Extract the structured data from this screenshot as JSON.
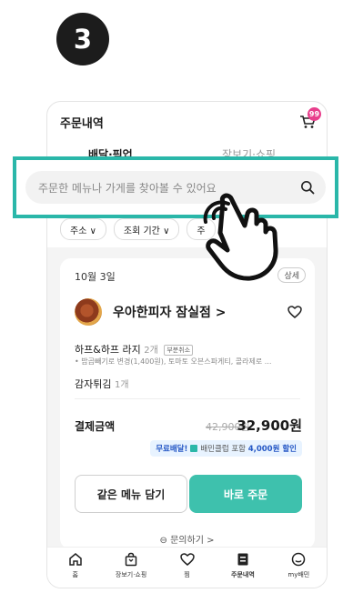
{
  "step_number": "3",
  "header": {
    "title": "주문내역",
    "cart_badge": "99"
  },
  "tabs": [
    {
      "label": "배달·픽업",
      "active": true
    },
    {
      "label": "장보기·쇼핑",
      "active": false
    }
  ],
  "search": {
    "placeholder": "주문한 메뉴나 가게를 찾아볼 수 있어요"
  },
  "filters": [
    "주소 ∨",
    "조회 기간 ∨",
    "주"
  ],
  "order": {
    "date": "10월 3일",
    "detail_label": "상세",
    "store_name": "우아한피자 잠실점 >",
    "menu1_name": "하프&하프 라지",
    "menu1_qty": "2개",
    "menu1_tag": "부분취소",
    "menu1_option": "• 밥곱빼기로 변경(1,400원), 토마토 오븐스파게티, 콜라제로 ...",
    "menu2_name": "감자튀김",
    "menu2_qty": "1개",
    "pay_label": "결제금액",
    "original_price": "42,900원",
    "final_price": "32,900원",
    "promo_prefix": "무료배달!",
    "promo_mid": "배민클럽 포함",
    "promo_discount": "4,000원 할인",
    "reorder_label": "같은 메뉴 담기",
    "order_now_label": "바로 주문"
  },
  "inquiry_label": "문의하기 >",
  "bottom_nav": [
    {
      "label": "홈",
      "icon": "home-icon"
    },
    {
      "label": "장보기·쇼핑",
      "icon": "shopping-bag-icon"
    },
    {
      "label": "찜",
      "icon": "heart-icon"
    },
    {
      "label": "주문내역",
      "icon": "receipt-icon",
      "active": true
    },
    {
      "label": "my배민",
      "icon": "smile-icon"
    }
  ],
  "colors": {
    "accent": "#2ab7a9",
    "badge": "#e83e8c",
    "order_button": "#3ec1ad"
  }
}
